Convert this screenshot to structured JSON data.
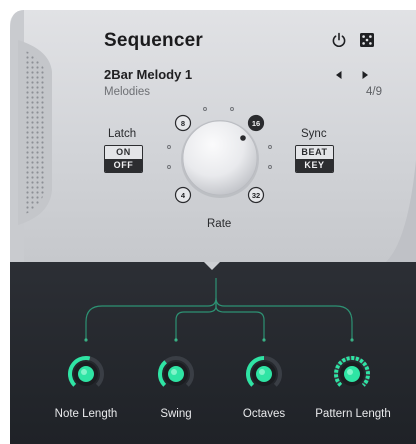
{
  "header": {
    "title": "Sequencer",
    "power_icon": "power-icon",
    "random_icon": "dice-icon"
  },
  "preset": {
    "name": "2Bar Melody 1",
    "category": "Melodies",
    "counter": "4/9",
    "prev_icon": "triangle-left-icon",
    "next_icon": "triangle-right-icon"
  },
  "latch": {
    "label": "Latch",
    "options": [
      "ON",
      "OFF"
    ],
    "selected": "OFF"
  },
  "sync": {
    "label": "Sync",
    "options": [
      "BEAT",
      "KEY"
    ],
    "selected": "KEY"
  },
  "rate": {
    "label": "Rate",
    "marks": [
      "8",
      "16",
      "4",
      "32"
    ],
    "selected_mark": "16"
  },
  "macros": [
    {
      "label": "Note Length",
      "level": 0.55
    },
    {
      "label": "Swing",
      "level": 0.35
    },
    {
      "label": "Octaves",
      "level": 0.5
    },
    {
      "label": "Pattern Length",
      "level": 1.0
    }
  ],
  "colors": {
    "accent": "#2fe4a4",
    "panel": "#d6d7db",
    "dark": "#24272c"
  }
}
